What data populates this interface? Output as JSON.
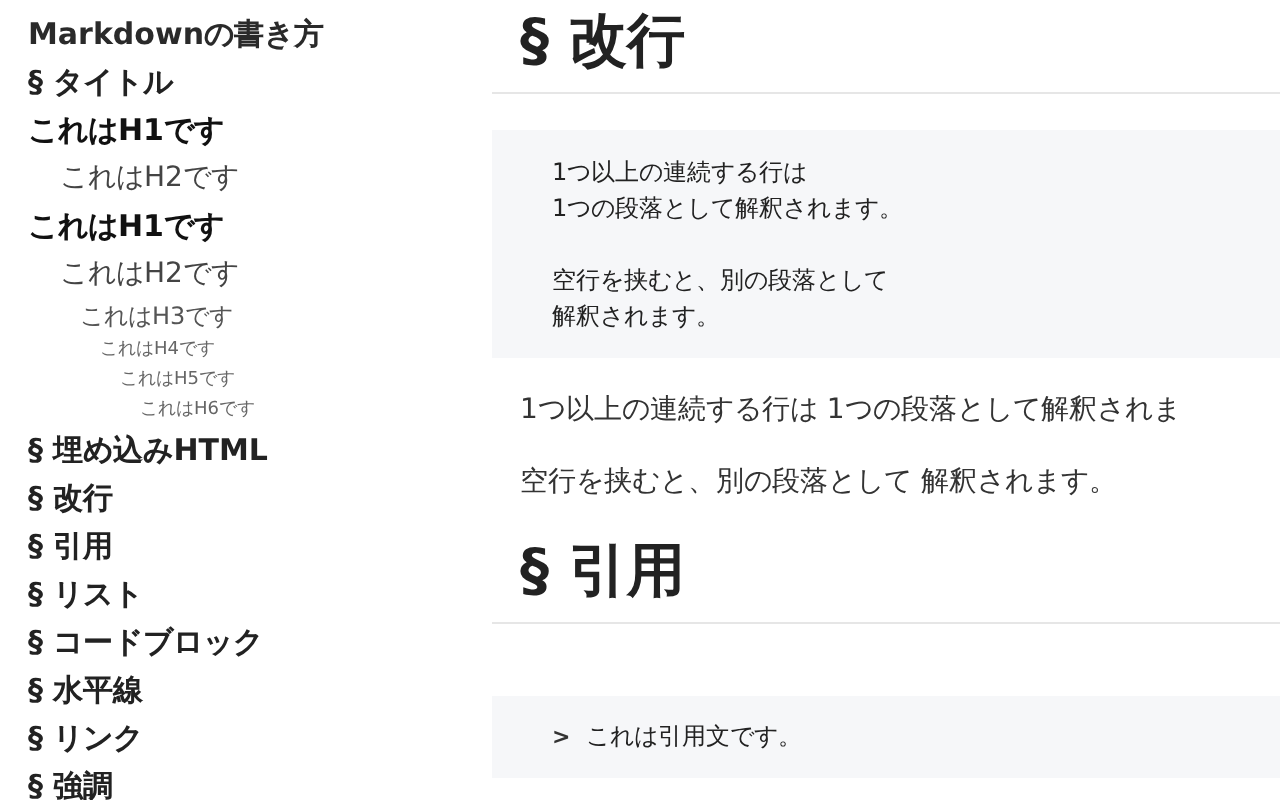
{
  "sidebar": {
    "items": [
      {
        "kind": "title",
        "label": "Markdownの書き方"
      },
      {
        "kind": "section",
        "label": "§ タイトル"
      },
      {
        "kind": "h1",
        "label": "これはH1です",
        "children": [
          {
            "kind": "h2",
            "label": "これはH2です"
          }
        ]
      },
      {
        "kind": "h1",
        "label": "これはH1です",
        "children": [
          {
            "kind": "h2",
            "label": "これはH2です",
            "children": [
              {
                "kind": "h3",
                "label": "これはH3です",
                "children": [
                  {
                    "kind": "h4",
                    "label": "これはH4です",
                    "children": [
                      {
                        "kind": "h5",
                        "label": "これはH5です",
                        "children": [
                          {
                            "kind": "h6",
                            "label": "これはH6です"
                          }
                        ]
                      }
                    ]
                  }
                ]
              }
            ]
          }
        ]
      },
      {
        "kind": "section",
        "label": "§ 埋め込みHTML"
      },
      {
        "kind": "section",
        "label": "§ 改行"
      },
      {
        "kind": "section",
        "label": "§ 引用"
      },
      {
        "kind": "section",
        "label": "§ リスト"
      },
      {
        "kind": "section",
        "label": "§ コードブロック"
      },
      {
        "kind": "section",
        "label": "§ 水平線"
      },
      {
        "kind": "section",
        "label": "§ リンク"
      },
      {
        "kind": "section",
        "label": "§ 強調"
      }
    ]
  },
  "content": [
    {
      "kind": "heading",
      "text": "§ 改行"
    },
    {
      "kind": "code",
      "paragraphs": [
        [
          "1つ以上の連続する行は",
          "1つの段落として解釈されます。"
        ],
        [
          "空行を挟むと、別の段落として",
          "解釈されます。"
        ]
      ]
    },
    {
      "kind": "paragraph",
      "text": "1つ以上の連続する行は 1つの段落として解釈されま"
    },
    {
      "kind": "paragraph",
      "text": "空行を挟むと、別の段落として 解釈されます。"
    },
    {
      "kind": "heading",
      "text": "§ 引用"
    },
    {
      "kind": "quote",
      "marker": ">",
      "text": "これは引用文です。"
    }
  ]
}
